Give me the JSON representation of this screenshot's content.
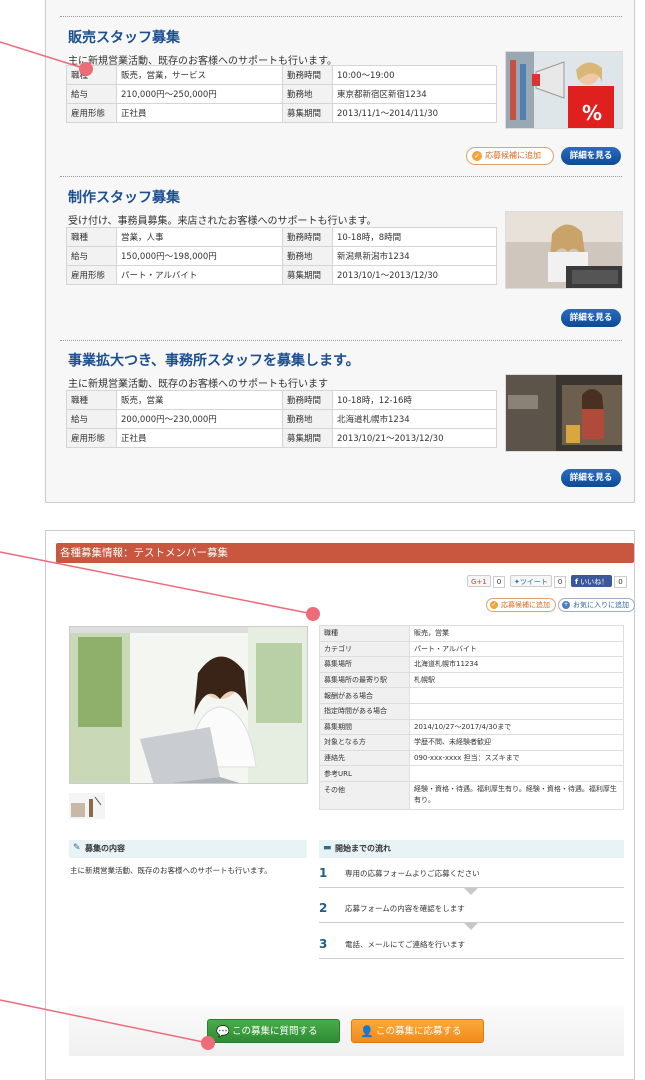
{
  "jobs": [
    {
      "title": "販売スタッフ募集",
      "desc": "主に新規営業活動、既存のお客様へのサポートも行います。",
      "rows": [
        {
          "k1": "職種",
          "v1": "販売，営業，サービス",
          "k2": "勤務時間",
          "v2": "10:00〜19:00"
        },
        {
          "k1": "給与",
          "v1": "210,000円〜250,000円",
          "k2": "勤務地",
          "v2": "東京都新宿区新宿1234"
        },
        {
          "k1": "雇用形態",
          "v1": "正社員",
          "k2": "募集期間",
          "v2": "2013/11/1〜2014/11/30"
        }
      ],
      "fav_label": "応募候補に追加",
      "detail_label": "詳細を見る"
    },
    {
      "title": "制作スタッフ募集",
      "desc": "受け付け、事務員募集。来店されたお客様へのサポートも行います。",
      "rows": [
        {
          "k1": "職種",
          "v1": "営業，人事",
          "k2": "勤務時間",
          "v2": "10-18時，8時間"
        },
        {
          "k1": "給与",
          "v1": "150,000円〜198,000円",
          "k2": "勤務地",
          "v2": "新潟県新潟市1234"
        },
        {
          "k1": "雇用形態",
          "v1": "パート・アルバイト",
          "k2": "募集期間",
          "v2": "2013/10/1〜2013/12/30"
        }
      ],
      "detail_label": "詳細を見る"
    },
    {
      "title": "事業拡大つき、事務所スタッフを募集します。",
      "desc": "主に新規営業活動、既存のお客様へのサポートも行います",
      "rows": [
        {
          "k1": "職種",
          "v1": "販売，営業",
          "k2": "勤務時間",
          "v2": "10-18時，12-16時"
        },
        {
          "k1": "給与",
          "v1": "200,000円〜230,000円",
          "k2": "勤務地",
          "v2": "北海道札幌市1234"
        },
        {
          "k1": "雇用形態",
          "v1": "正社員",
          "k2": "募集期間",
          "v2": "2013/10/21〜2013/12/30"
        }
      ],
      "detail_label": "詳細を見る"
    }
  ],
  "detail": {
    "header": "各種募集情報：テストメンバー募集",
    "share": {
      "gplus": "G+1",
      "gplus_count": "0",
      "tweet": "ツイート",
      "tweet_count": "0",
      "like": "いいね！",
      "like_count": "0"
    },
    "apply_candidate": "応募候補に追加",
    "add_favorite": "お気に入りに追加",
    "info": [
      {
        "k": "職種",
        "v": "販売，営業"
      },
      {
        "k": "カテゴリ",
        "v": "パート・アルバイト"
      },
      {
        "k": "募集場所",
        "v": "北海道札幌市11234"
      },
      {
        "k": "募集場所の最寄り駅",
        "v": "札幌駅"
      },
      {
        "k": "報酬がある場合",
        "v": ""
      },
      {
        "k": "指定時間がある場合",
        "v": ""
      },
      {
        "k": "募集期間",
        "v": "2014/10/27〜2017/4/30まで"
      },
      {
        "k": "対象となる方",
        "v": "学歴不問、未経験者歓迎"
      },
      {
        "k": "連絡先",
        "v": "090-xxx-xxxx 担当：スズキまで"
      },
      {
        "k": "参考URL",
        "v": ""
      },
      {
        "k": "その他",
        "v": "経験・資格・待遇。福利厚生有り。経験・資格・待遇。福利厚生有り。"
      }
    ],
    "content_title": "募集の内容",
    "content_text": "主に新規営業活動、既存のお客様へのサポートも行います。",
    "flow_title": "開始までの流れ",
    "steps": [
      {
        "num": "1",
        "text": "専用の応募フォームよりご応募ください"
      },
      {
        "num": "2",
        "text": "応募フォームの内容を確認をします"
      },
      {
        "num": "3",
        "text": "電話、メールにてご連絡を行います"
      }
    ],
    "question_button": "この募集に質問する",
    "apply_button": "この募集に応募する"
  },
  "colors": {
    "title_blue": "#1b4f8f",
    "header_red": "#c9563f",
    "annotation_pink": "#ee6b7a"
  }
}
